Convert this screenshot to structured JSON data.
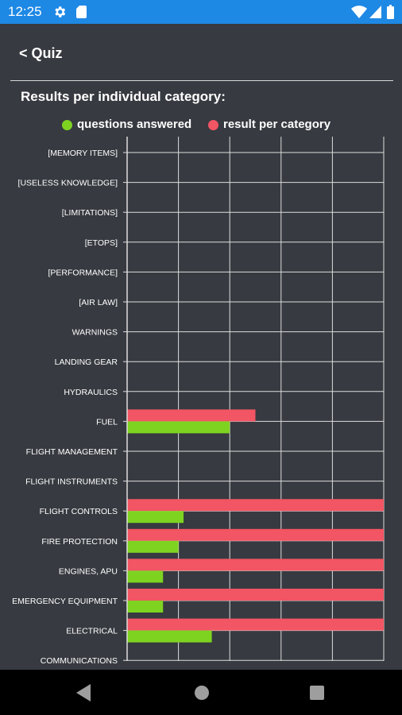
{
  "status_bar": {
    "time": "12:25",
    "icons": [
      "gear-icon",
      "sd-card-icon",
      "wifi-icon",
      "signal-icon",
      "battery-icon"
    ]
  },
  "header": {
    "back_label": "< Quiz"
  },
  "section_title": "Results per individual category:",
  "colors": {
    "background": "#373a40",
    "status_bar": "#1e88e5",
    "questions_answered": "#7ed321",
    "result_per_category": "#f25563",
    "grid": "#dddddd"
  },
  "legend": {
    "questions_answered": "questions answered",
    "result_per_category": "result per category"
  },
  "chart_data": {
    "type": "bar",
    "orientation": "horizontal",
    "grid": true,
    "legend_position": "top",
    "xlim": [
      0,
      100
    ],
    "categories": [
      "[MEMORY ITEMS]",
      "[USELESS KNOWLEDGE]",
      "[LIMITATIONS]",
      "[ETOPS]",
      "[PERFORMANCE]",
      "[AIR LAW]",
      "WARNINGS",
      "LANDING GEAR",
      "HYDRAULICS",
      "FUEL",
      "FLIGHT MANAGEMENT",
      "FLIGHT INSTRUMENTS",
      "FLIGHT CONTROLS",
      "FIRE PROTECTION",
      "ENGINES, APU",
      "EMERGENCY EQUIPMENT",
      "ELECTRICAL",
      "COMMUNICATIONS"
    ],
    "series": [
      {
        "name": "result per category",
        "values": [
          0,
          0,
          0,
          0,
          0,
          0,
          0,
          0,
          0,
          50,
          0,
          0,
          100,
          100,
          100,
          100,
          100,
          0
        ]
      },
      {
        "name": "questions answered",
        "values": [
          0,
          0,
          0,
          0,
          0,
          0,
          0,
          0,
          0,
          40,
          0,
          0,
          22,
          20,
          14,
          14,
          33,
          0
        ]
      }
    ]
  },
  "nav_bar": {
    "icons": [
      "back-triangle-icon",
      "home-circle-icon",
      "recent-apps-square-icon"
    ]
  }
}
